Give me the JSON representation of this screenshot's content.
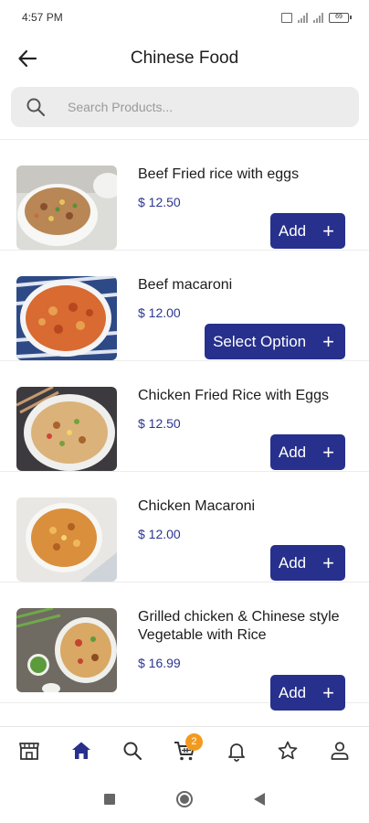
{
  "status_bar": {
    "time": "4:57 PM",
    "battery": "69"
  },
  "header": {
    "title": "Chinese Food"
  },
  "search": {
    "placeholder": "Search Products..."
  },
  "products": [
    {
      "name": "Beef Fried rice with eggs",
      "price": "$ 12.50",
      "button": "Add"
    },
    {
      "name": "Beef macaroni",
      "price": "$ 12.00",
      "button": "Select Option"
    },
    {
      "name": "Chicken Fried Rice with Eggs",
      "price": "$ 12.50",
      "button": "Add"
    },
    {
      "name": "Chicken Macaroni",
      "price": "$ 12.00",
      "button": "Add"
    },
    {
      "name": "Grilled chicken & Chinese style Vegetable with Rice",
      "price": "$ 16.99",
      "button": "Add"
    }
  ],
  "bottom_nav": {
    "items": [
      "store-icon",
      "home-icon",
      "search-icon",
      "cart-icon",
      "bell-icon",
      "star-icon",
      "user-icon"
    ],
    "active": "home-icon",
    "cart_count": "2"
  },
  "colors": {
    "primary": "#27308c",
    "price": "#2b3590",
    "badge": "#f39a1e"
  }
}
